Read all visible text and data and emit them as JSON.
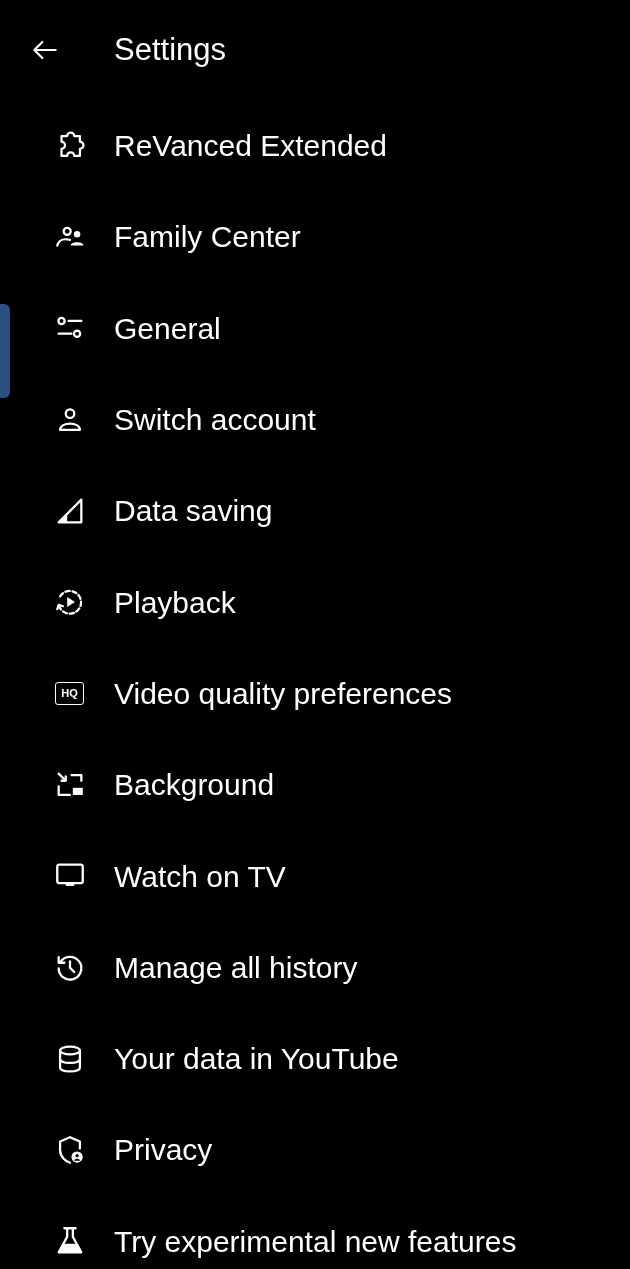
{
  "header": {
    "title": "Settings"
  },
  "items": [
    {
      "label": "ReVanced Extended"
    },
    {
      "label": "Family Center"
    },
    {
      "label": "General"
    },
    {
      "label": "Switch account"
    },
    {
      "label": "Data saving"
    },
    {
      "label": "Playback"
    },
    {
      "label": "Video quality preferences",
      "icon_text": "HQ"
    },
    {
      "label": "Background"
    },
    {
      "label": "Watch on TV"
    },
    {
      "label": "Manage all history"
    },
    {
      "label": "Your data in YouTube"
    },
    {
      "label": "Privacy"
    },
    {
      "label": "Try experimental new features"
    }
  ]
}
